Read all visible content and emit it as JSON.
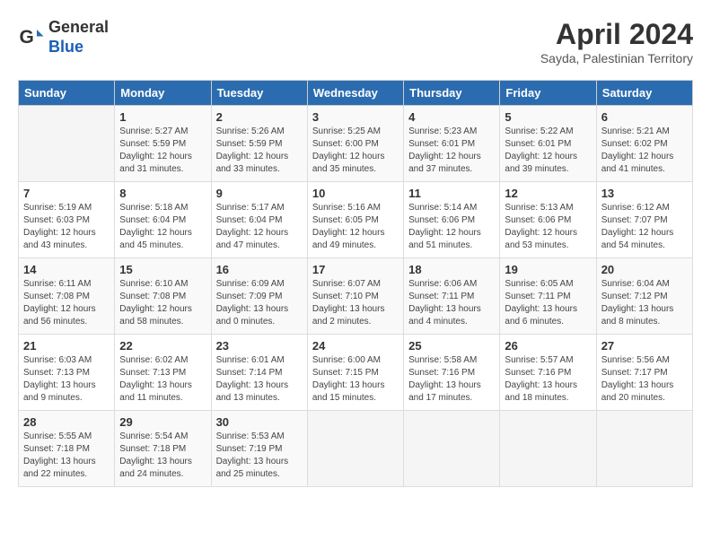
{
  "header": {
    "logo_line1": "General",
    "logo_line2": "Blue",
    "month": "April 2024",
    "location": "Sayda, Palestinian Territory"
  },
  "days_of_week": [
    "Sunday",
    "Monday",
    "Tuesday",
    "Wednesday",
    "Thursday",
    "Friday",
    "Saturday"
  ],
  "weeks": [
    [
      {
        "day": "",
        "info": ""
      },
      {
        "day": "1",
        "info": "Sunrise: 5:27 AM\nSunset: 5:59 PM\nDaylight: 12 hours\nand 31 minutes."
      },
      {
        "day": "2",
        "info": "Sunrise: 5:26 AM\nSunset: 5:59 PM\nDaylight: 12 hours\nand 33 minutes."
      },
      {
        "day": "3",
        "info": "Sunrise: 5:25 AM\nSunset: 6:00 PM\nDaylight: 12 hours\nand 35 minutes."
      },
      {
        "day": "4",
        "info": "Sunrise: 5:23 AM\nSunset: 6:01 PM\nDaylight: 12 hours\nand 37 minutes."
      },
      {
        "day": "5",
        "info": "Sunrise: 5:22 AM\nSunset: 6:01 PM\nDaylight: 12 hours\nand 39 minutes."
      },
      {
        "day": "6",
        "info": "Sunrise: 5:21 AM\nSunset: 6:02 PM\nDaylight: 12 hours\nand 41 minutes."
      }
    ],
    [
      {
        "day": "7",
        "info": "Sunrise: 5:19 AM\nSunset: 6:03 PM\nDaylight: 12 hours\nand 43 minutes."
      },
      {
        "day": "8",
        "info": "Sunrise: 5:18 AM\nSunset: 6:04 PM\nDaylight: 12 hours\nand 45 minutes."
      },
      {
        "day": "9",
        "info": "Sunrise: 5:17 AM\nSunset: 6:04 PM\nDaylight: 12 hours\nand 47 minutes."
      },
      {
        "day": "10",
        "info": "Sunrise: 5:16 AM\nSunset: 6:05 PM\nDaylight: 12 hours\nand 49 minutes."
      },
      {
        "day": "11",
        "info": "Sunrise: 5:14 AM\nSunset: 6:06 PM\nDaylight: 12 hours\nand 51 minutes."
      },
      {
        "day": "12",
        "info": "Sunrise: 5:13 AM\nSunset: 6:06 PM\nDaylight: 12 hours\nand 53 minutes."
      },
      {
        "day": "13",
        "info": "Sunrise: 6:12 AM\nSunset: 7:07 PM\nDaylight: 12 hours\nand 54 minutes."
      }
    ],
    [
      {
        "day": "14",
        "info": "Sunrise: 6:11 AM\nSunset: 7:08 PM\nDaylight: 12 hours\nand 56 minutes."
      },
      {
        "day": "15",
        "info": "Sunrise: 6:10 AM\nSunset: 7:08 PM\nDaylight: 12 hours\nand 58 minutes."
      },
      {
        "day": "16",
        "info": "Sunrise: 6:09 AM\nSunset: 7:09 PM\nDaylight: 13 hours\nand 0 minutes."
      },
      {
        "day": "17",
        "info": "Sunrise: 6:07 AM\nSunset: 7:10 PM\nDaylight: 13 hours\nand 2 minutes."
      },
      {
        "day": "18",
        "info": "Sunrise: 6:06 AM\nSunset: 7:11 PM\nDaylight: 13 hours\nand 4 minutes."
      },
      {
        "day": "19",
        "info": "Sunrise: 6:05 AM\nSunset: 7:11 PM\nDaylight: 13 hours\nand 6 minutes."
      },
      {
        "day": "20",
        "info": "Sunrise: 6:04 AM\nSunset: 7:12 PM\nDaylight: 13 hours\nand 8 minutes."
      }
    ],
    [
      {
        "day": "21",
        "info": "Sunrise: 6:03 AM\nSunset: 7:13 PM\nDaylight: 13 hours\nand 9 minutes."
      },
      {
        "day": "22",
        "info": "Sunrise: 6:02 AM\nSunset: 7:13 PM\nDaylight: 13 hours\nand 11 minutes."
      },
      {
        "day": "23",
        "info": "Sunrise: 6:01 AM\nSunset: 7:14 PM\nDaylight: 13 hours\nand 13 minutes."
      },
      {
        "day": "24",
        "info": "Sunrise: 6:00 AM\nSunset: 7:15 PM\nDaylight: 13 hours\nand 15 minutes."
      },
      {
        "day": "25",
        "info": "Sunrise: 5:58 AM\nSunset: 7:16 PM\nDaylight: 13 hours\nand 17 minutes."
      },
      {
        "day": "26",
        "info": "Sunrise: 5:57 AM\nSunset: 7:16 PM\nDaylight: 13 hours\nand 18 minutes."
      },
      {
        "day": "27",
        "info": "Sunrise: 5:56 AM\nSunset: 7:17 PM\nDaylight: 13 hours\nand 20 minutes."
      }
    ],
    [
      {
        "day": "28",
        "info": "Sunrise: 5:55 AM\nSunset: 7:18 PM\nDaylight: 13 hours\nand 22 minutes."
      },
      {
        "day": "29",
        "info": "Sunrise: 5:54 AM\nSunset: 7:18 PM\nDaylight: 13 hours\nand 24 minutes."
      },
      {
        "day": "30",
        "info": "Sunrise: 5:53 AM\nSunset: 7:19 PM\nDaylight: 13 hours\nand 25 minutes."
      },
      {
        "day": "",
        "info": ""
      },
      {
        "day": "",
        "info": ""
      },
      {
        "day": "",
        "info": ""
      },
      {
        "day": "",
        "info": ""
      }
    ]
  ]
}
